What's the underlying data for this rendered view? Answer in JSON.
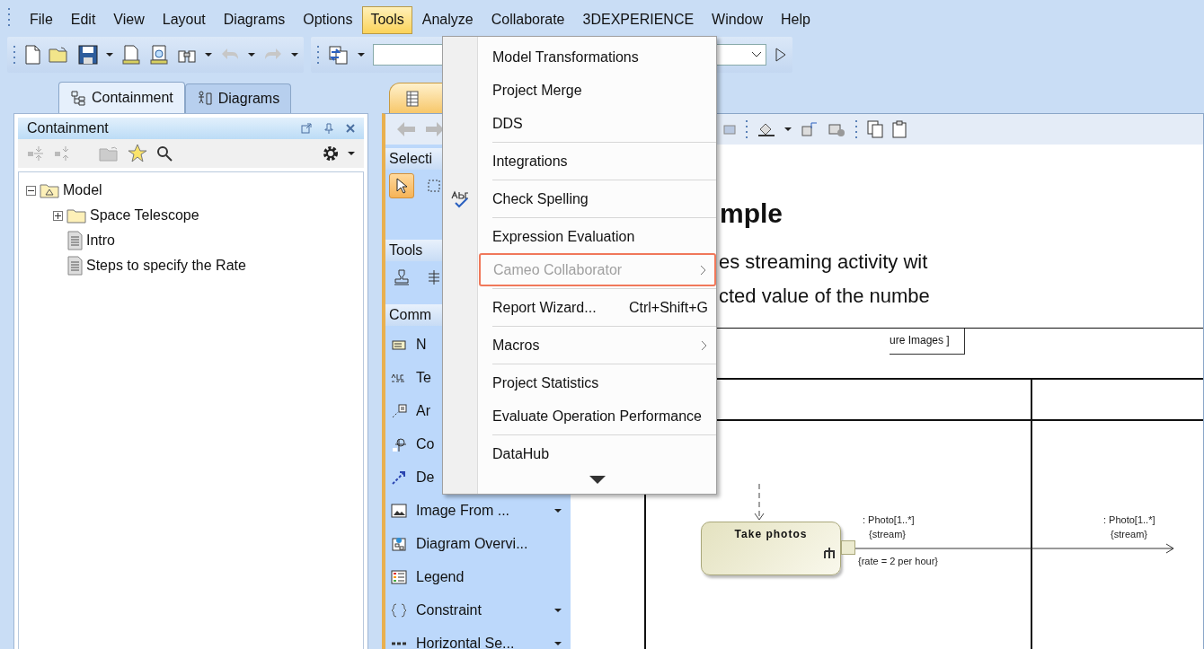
{
  "menu_bar": [
    {
      "label": "File",
      "selected": false
    },
    {
      "label": "Edit",
      "selected": false
    },
    {
      "label": "View",
      "selected": false
    },
    {
      "label": "Layout",
      "selected": false
    },
    {
      "label": "Diagrams",
      "selected": false
    },
    {
      "label": "Options",
      "selected": false
    },
    {
      "label": "Tools",
      "selected": true
    },
    {
      "label": "Analyze",
      "selected": false
    },
    {
      "label": "Collaborate",
      "selected": false
    },
    {
      "label": "3DEXPERIENCE",
      "selected": false
    },
    {
      "label": "Window",
      "selected": false
    },
    {
      "label": "Help",
      "selected": false
    }
  ],
  "tools_menu": {
    "items": [
      {
        "kind": "item",
        "label": "Model Transformations",
        "disabled": false,
        "highlighted": false
      },
      {
        "kind": "item",
        "label": "Project Merge",
        "disabled": false,
        "highlighted": false
      },
      {
        "kind": "item",
        "label": "DDS",
        "disabled": false,
        "highlighted": false
      },
      {
        "kind": "separator"
      },
      {
        "kind": "item",
        "label": "Integrations",
        "disabled": false,
        "highlighted": false
      },
      {
        "kind": "separator"
      },
      {
        "kind": "item",
        "label": "Check Spelling",
        "disabled": false,
        "highlighted": false,
        "has_icon": true
      },
      {
        "kind": "separator"
      },
      {
        "kind": "item",
        "label": "Expression Evaluation",
        "disabled": false,
        "highlighted": false
      },
      {
        "kind": "item",
        "label": "Cameo Collaborator",
        "disabled": true,
        "highlighted": true,
        "submenu": true
      },
      {
        "kind": "separator"
      },
      {
        "kind": "item",
        "label": "Report Wizard...",
        "disabled": false,
        "highlighted": false,
        "shortcut": "Ctrl+Shift+G"
      },
      {
        "kind": "separator"
      },
      {
        "kind": "item",
        "label": "Macros",
        "disabled": false,
        "highlighted": false,
        "submenu": true
      },
      {
        "kind": "separator"
      },
      {
        "kind": "item",
        "label": "Project Statistics",
        "disabled": false,
        "highlighted": false
      },
      {
        "kind": "item",
        "label": "Evaluate Operation Performance",
        "disabled": false,
        "highlighted": false
      },
      {
        "kind": "separator"
      },
      {
        "kind": "item",
        "label": "DataHub",
        "disabled": false,
        "highlighted": false
      }
    ]
  },
  "left_panel": {
    "tabs": [
      {
        "label": "Containment",
        "selected": true
      },
      {
        "label": "Diagrams",
        "selected": false
      }
    ],
    "title": "Containment",
    "tree": [
      {
        "label": "Model",
        "kind": "model",
        "expanded": true,
        "children": [
          {
            "label": "Space Telescope",
            "kind": "package",
            "expanded": false
          },
          {
            "label": "Intro",
            "kind": "document"
          },
          {
            "label": "Steps to specify the Rate",
            "kind": "document"
          }
        ]
      }
    ]
  },
  "palette": [
    {
      "kind": "header",
      "label": "Selecti"
    },
    {
      "kind": "buttons",
      "buttons": [
        {
          "selected": true
        },
        {
          "selected": false
        }
      ]
    },
    {
      "kind": "header",
      "label": "Tools"
    },
    {
      "kind": "buttons",
      "buttons": [
        {
          "selected": false
        },
        {
          "selected": false
        }
      ]
    },
    {
      "kind": "header",
      "label": "Comm"
    },
    {
      "kind": "tool",
      "label": "N",
      "dropdown": false
    },
    {
      "kind": "tool",
      "label": "Te",
      "dropdown": false
    },
    {
      "kind": "tool",
      "label": "Ar",
      "dropdown": false
    },
    {
      "kind": "tool",
      "label": "Co",
      "dropdown": false
    },
    {
      "kind": "tool",
      "label": "De",
      "dropdown": false
    },
    {
      "kind": "tool",
      "label": "Image From ...",
      "dropdown": true
    },
    {
      "kind": "tool",
      "label": "Diagram Overvi...",
      "dropdown": false
    },
    {
      "kind": "tool",
      "label": "Legend",
      "dropdown": false
    },
    {
      "kind": "tool",
      "label": "Constraint",
      "dropdown": true
    },
    {
      "kind": "tool",
      "label": "Horizontal Se...",
      "dropdown": true
    }
  ],
  "diagram": {
    "title": "mple",
    "description": [
      "es streaming activity wit",
      "cted value of the numbe"
    ],
    "frame_label": "ure Images ]",
    "action": "Take photos",
    "pin_labels": [
      {
        "name": ": Photo[1..*]",
        "stream": "{stream}"
      },
      {
        "name": ": Photo[1..*]",
        "stream": "{stream}"
      }
    ],
    "rate": "{rate = 2 per hour}"
  }
}
